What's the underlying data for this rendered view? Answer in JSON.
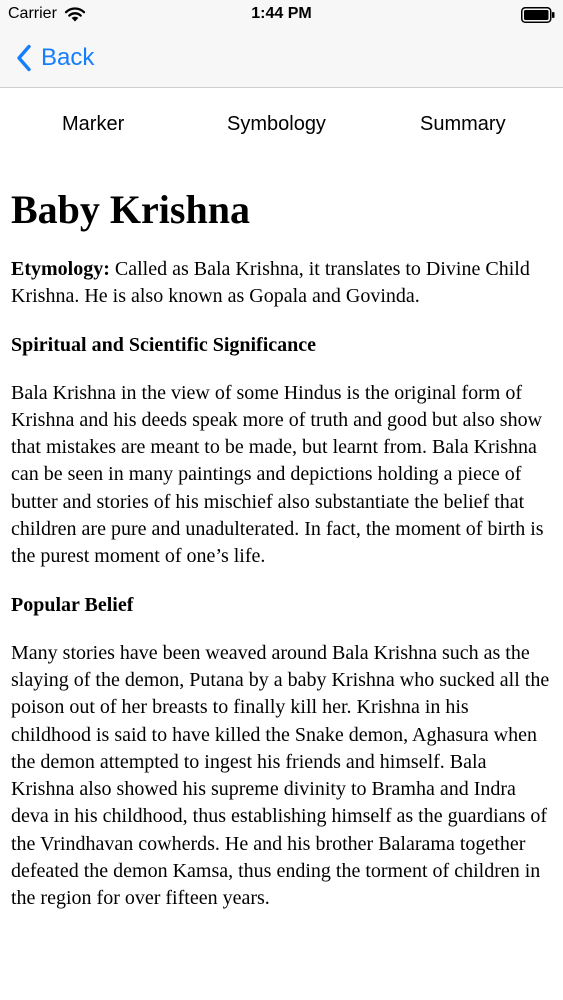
{
  "status_bar": {
    "carrier": "Carrier",
    "time": "1:44 PM",
    "wifi_icon": "wifi-icon",
    "battery_icon": "battery-icon"
  },
  "nav": {
    "back_label": "Back",
    "back_icon": "chevron-left-icon",
    "accent_color": "#157efb"
  },
  "tabs": [
    {
      "label": "Marker"
    },
    {
      "label": "Symbology"
    },
    {
      "label": "Summary"
    }
  ],
  "article": {
    "title": "Baby Krishna",
    "etymology_label": "Etymology:",
    "etymology_text": " Called as Bala Krishna, it translates to Divine Child Krishna. He is also known as Gopala and Govinda.",
    "sections": [
      {
        "heading": "Spiritual and Scientific Significance",
        "body": "Bala Krishna in the view of some Hindus is the original form of Krishna and his deeds speak more of truth and good but also show that mistakes are meant to be made, but learnt from. Bala Krishna can be seen in many paintings and depictions holding a piece of butter and stories of his mischief also substantiate the belief that children are pure and unadulterated. In fact, the moment of birth is the purest moment of one’s life."
      },
      {
        "heading": "Popular Belief",
        "body": "Many stories have been weaved around Bala Krishna such as the slaying of the demon, Putana by a baby Krishna who sucked all the poison out of her breasts to finally kill her. Krishna in his childhood is said to have killed the Snake demon, Aghasura when the demon attempted to ingest his friends and himself. Bala Krishna also showed his supreme divinity to Bramha and Indra deva in his childhood, thus establishing himself as the guardians of the Vrindhavan cowherds. He and his brother Balarama together defeated the demon Kamsa, thus ending the torment of children in the region for over fifteen years."
      }
    ]
  }
}
